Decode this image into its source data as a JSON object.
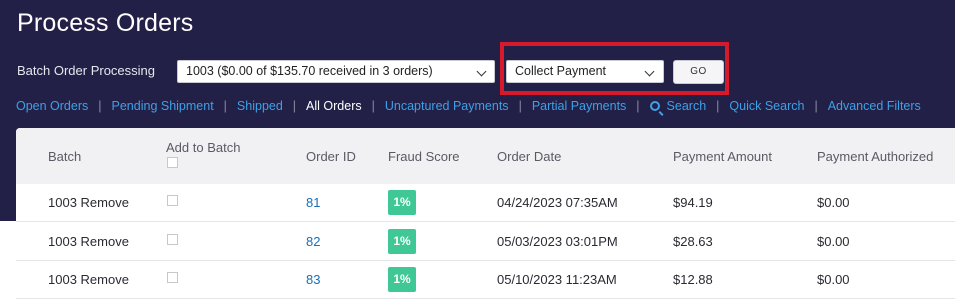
{
  "page": {
    "title": "Process Orders"
  },
  "batch": {
    "label": "Batch Order Processing",
    "selected": "1003 ($0.00 of $135.70 received in 3 orders)",
    "action_selected": "Collect Payment",
    "go_label": "GO"
  },
  "nav": {
    "items": [
      {
        "label": "Open Orders",
        "active": false
      },
      {
        "label": "Pending Shipment",
        "active": false
      },
      {
        "label": "Shipped",
        "active": false
      },
      {
        "label": "All Orders",
        "active": true
      },
      {
        "label": "Uncaptured Payments",
        "active": false
      },
      {
        "label": "Partial Payments",
        "active": false
      },
      {
        "label": "Search",
        "active": false,
        "icon": "search-icon"
      },
      {
        "label": "Quick Search",
        "active": false
      },
      {
        "label": "Advanced Filters",
        "active": false
      }
    ]
  },
  "table": {
    "headers": {
      "batch": "Batch",
      "add_to_batch": "Add to Batch",
      "order_id": "Order ID",
      "fraud_score": "Fraud Score",
      "order_date": "Order Date",
      "payment_amount": "Payment Amount",
      "payment_authorized": "Payment Authorized"
    },
    "rows": [
      {
        "batch": "1003 Remove",
        "order_id": "81",
        "fraud": "1%",
        "date": "04/24/2023 07:35AM",
        "amount": "$94.19",
        "authorized": "$0.00"
      },
      {
        "batch": "1003 Remove",
        "order_id": "82",
        "fraud": "1%",
        "date": "05/03/2023 03:01PM",
        "amount": "$28.63",
        "authorized": "$0.00"
      },
      {
        "batch": "1003 Remove",
        "order_id": "83",
        "fraud": "1%",
        "date": "05/10/2023 11:23AM",
        "amount": "$12.88",
        "authorized": "$0.00"
      }
    ]
  },
  "colors": {
    "header_bg": "#222046",
    "link": "#3ea0e8",
    "highlight": "#d61a2b",
    "fraud_badge": "#3fc796"
  }
}
